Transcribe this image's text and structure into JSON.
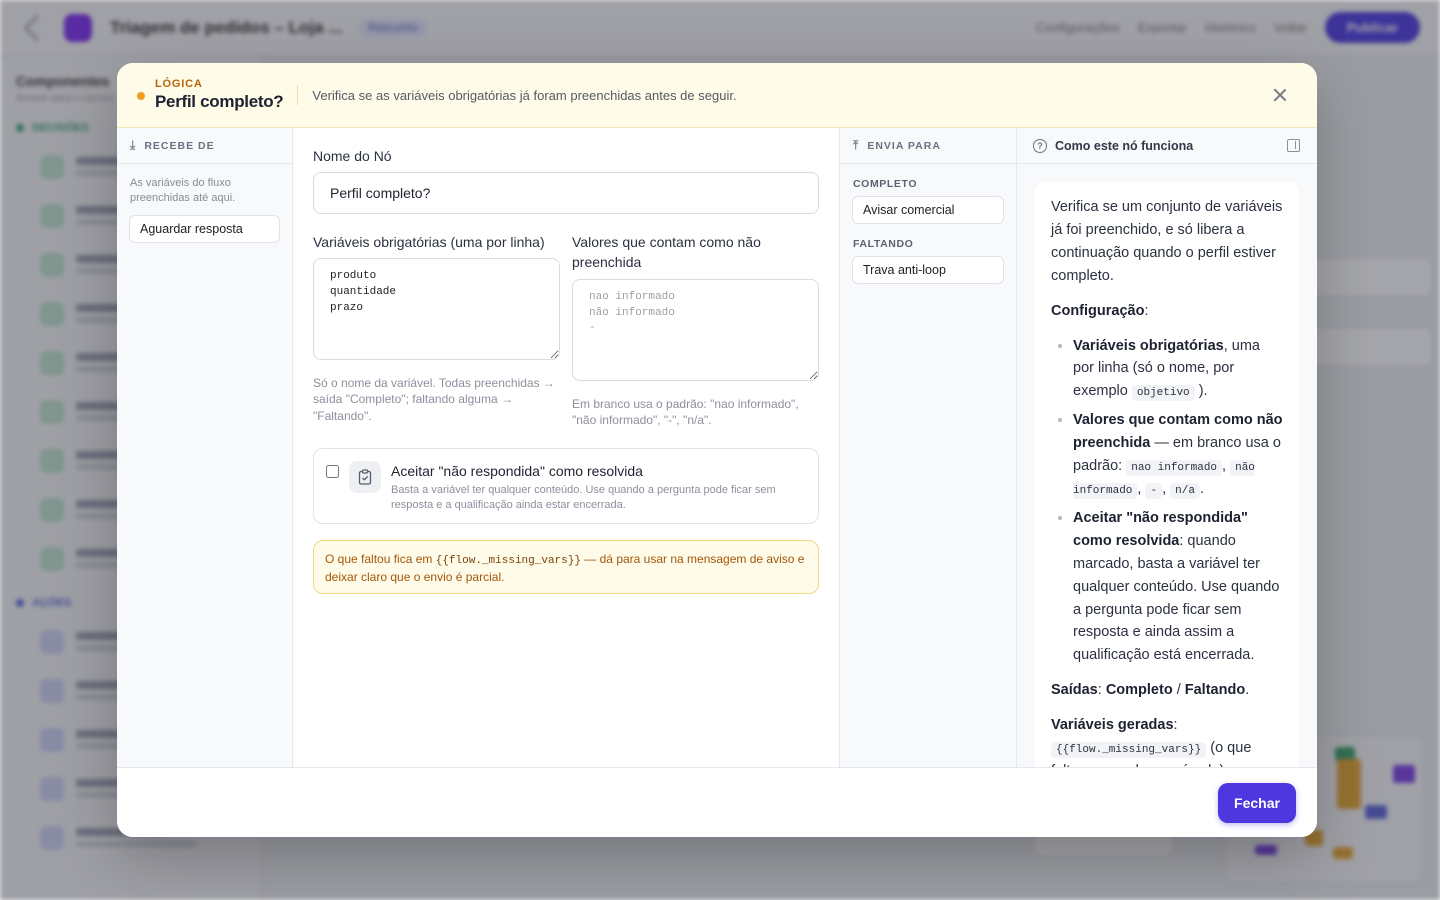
{
  "app": {
    "title": "Triagem de pedidos – Loja ...",
    "tag": "Rascunho",
    "actions": [
      "Configurações",
      "Exportar",
      "Histórico",
      "Voltar"
    ],
    "publish_label": "Publicar",
    "sidebar_title": "Componentes",
    "sidebar_sub": "Arraste para o canvas",
    "section_a": "DECISÕES",
    "section_b": "AÇÕES"
  },
  "modal": {
    "category": "LÓGICA",
    "title": "Perfil completo?",
    "description": "Verifica se as variáveis obrigatórias já foram preenchidas antes de seguir.",
    "receives": {
      "heading": "RECEBE DE",
      "note": "As variáveis do fluxo preenchidas até aqui.",
      "items": [
        "Aguardar resposta"
      ]
    },
    "form": {
      "name_label": "Nome do Nó",
      "name_value": "Perfil completo?",
      "required_label": "Variáveis obrigatórias (uma por linha)",
      "required_value": "produto\nquantidade\nprazo",
      "required_hint": "Só o nome da variável. Todas preenchidas → saída \"Completo\"; faltando alguma → \"Faltando\".",
      "empty_label": "Valores que contam como não preenchida",
      "empty_placeholder": "nao informado\nnão informado\n-",
      "empty_hint": "Em branco usa o padrão: \"nao informado\", \"não informado\", \"-\", \"n/a\".",
      "accept_title": "Aceitar \"não respondida\" como resolvida",
      "accept_desc": "Basta a variável ter qualquer conteúdo. Use quando a pergunta pode ficar sem resposta e a qualificação ainda estar encerrada.",
      "notice_pre": "O que faltou fica em ",
      "notice_code": "{{flow._missing_vars}}",
      "notice_post": " — dá para usar na mensagem de aviso e deixar claro que o envio é parcial."
    },
    "sends": {
      "heading": "ENVIA PARA",
      "outputs": [
        {
          "label": "COMPLETO",
          "target": "Avisar comercial"
        },
        {
          "label": "FALTANDO",
          "target": "Trava anti-loop"
        }
      ]
    },
    "help": {
      "heading": "Como este nó funciona",
      "intro": "Verifica se um conjunto de variáveis já foi preenchido, e só libera a continuação quando o perfil estiver completo.",
      "config_title": "Configuração",
      "b1_bold": "Variáveis obrigatórias",
      "b1_text": ", uma por linha (só o nome, por exemplo ",
      "b1_code": "objetivo",
      "b1_end": ").",
      "b2_bold": "Valores que contam como não preenchida",
      "b2_text": " — em branco usa o padrão: ",
      "b2_codes": [
        "nao informado",
        "não informado",
        "-",
        "n/a"
      ],
      "b3_bold": "Aceitar \"não respondida\" como resolvida",
      "b3_text": ": quando marcado, basta a variável ter qualquer conteúdo. Use quando a pergunta pode ficar sem resposta e ainda assim a qualificação está encerrada.",
      "outputs_title": "Saídas",
      "out1": "Completo",
      "out2": "Faltando",
      "vars_title": "Variáveis geradas",
      "vars_code": "{{flow._missing_vars}}",
      "vars_text": "(o que falta, separado por vírgula)."
    },
    "close_label": "Fechar"
  },
  "colors": {
    "accent": "#4e37de",
    "warning_bg": "#fefbe8",
    "category": "#b6640b"
  }
}
